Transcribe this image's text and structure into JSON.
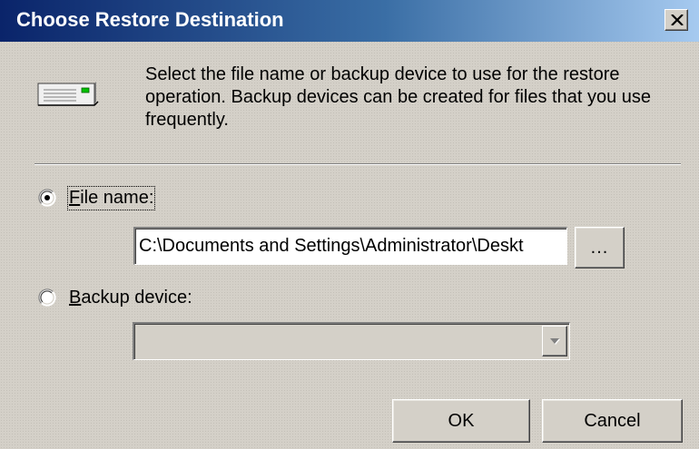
{
  "window": {
    "title": "Choose Restore Destination"
  },
  "icons": {
    "close": "close-icon",
    "device": "backup-device-icon",
    "dropdown": "chevron-down-icon"
  },
  "description": "Select the file name or backup device to use for the restore operation.  Backup devices can be created for files that you use frequently.",
  "file_name_option": {
    "mnemonic": "F",
    "label_rest": "ile name:",
    "selected": true
  },
  "file_input": {
    "value": "C:\\Documents and Settings\\Administrator\\Deskt"
  },
  "browse_button": {
    "label": "..."
  },
  "backup_device_option": {
    "mnemonic": "B",
    "label_rest": "ackup device:",
    "selected": false
  },
  "backup_device_select": {
    "value": "",
    "disabled": true
  },
  "buttons": {
    "ok": "OK",
    "cancel": "Cancel"
  },
  "colors": {
    "titlebar_start": "#0a246a",
    "titlebar_end": "#a6caf0",
    "dialog_face": "#d4d0c8"
  }
}
